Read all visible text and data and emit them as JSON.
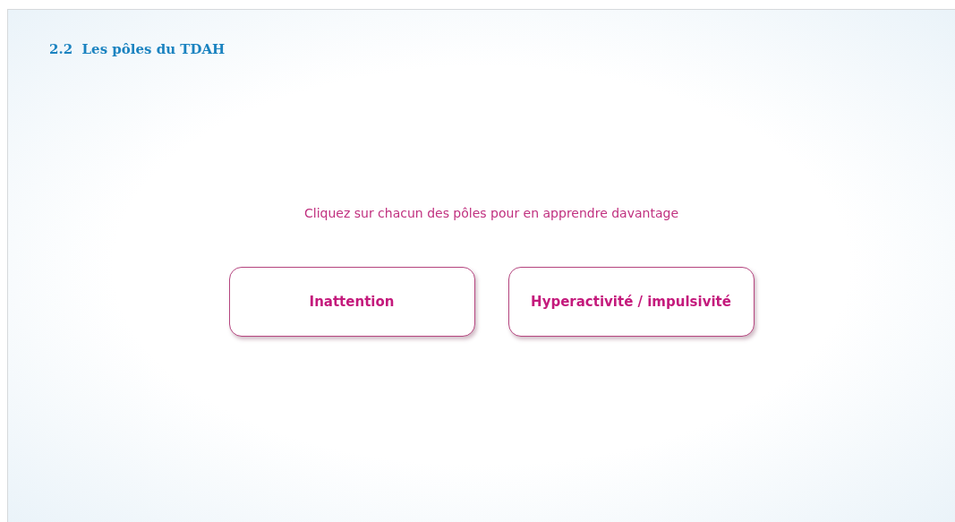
{
  "title": "2.2  Les pôles du TDAH",
  "instruction": "Cliquez sur chacun des pôles pour en apprendre davantage",
  "buttons": [
    {
      "label": "Inattention"
    },
    {
      "label": "Hyperactivité / impulsivité"
    }
  ]
}
